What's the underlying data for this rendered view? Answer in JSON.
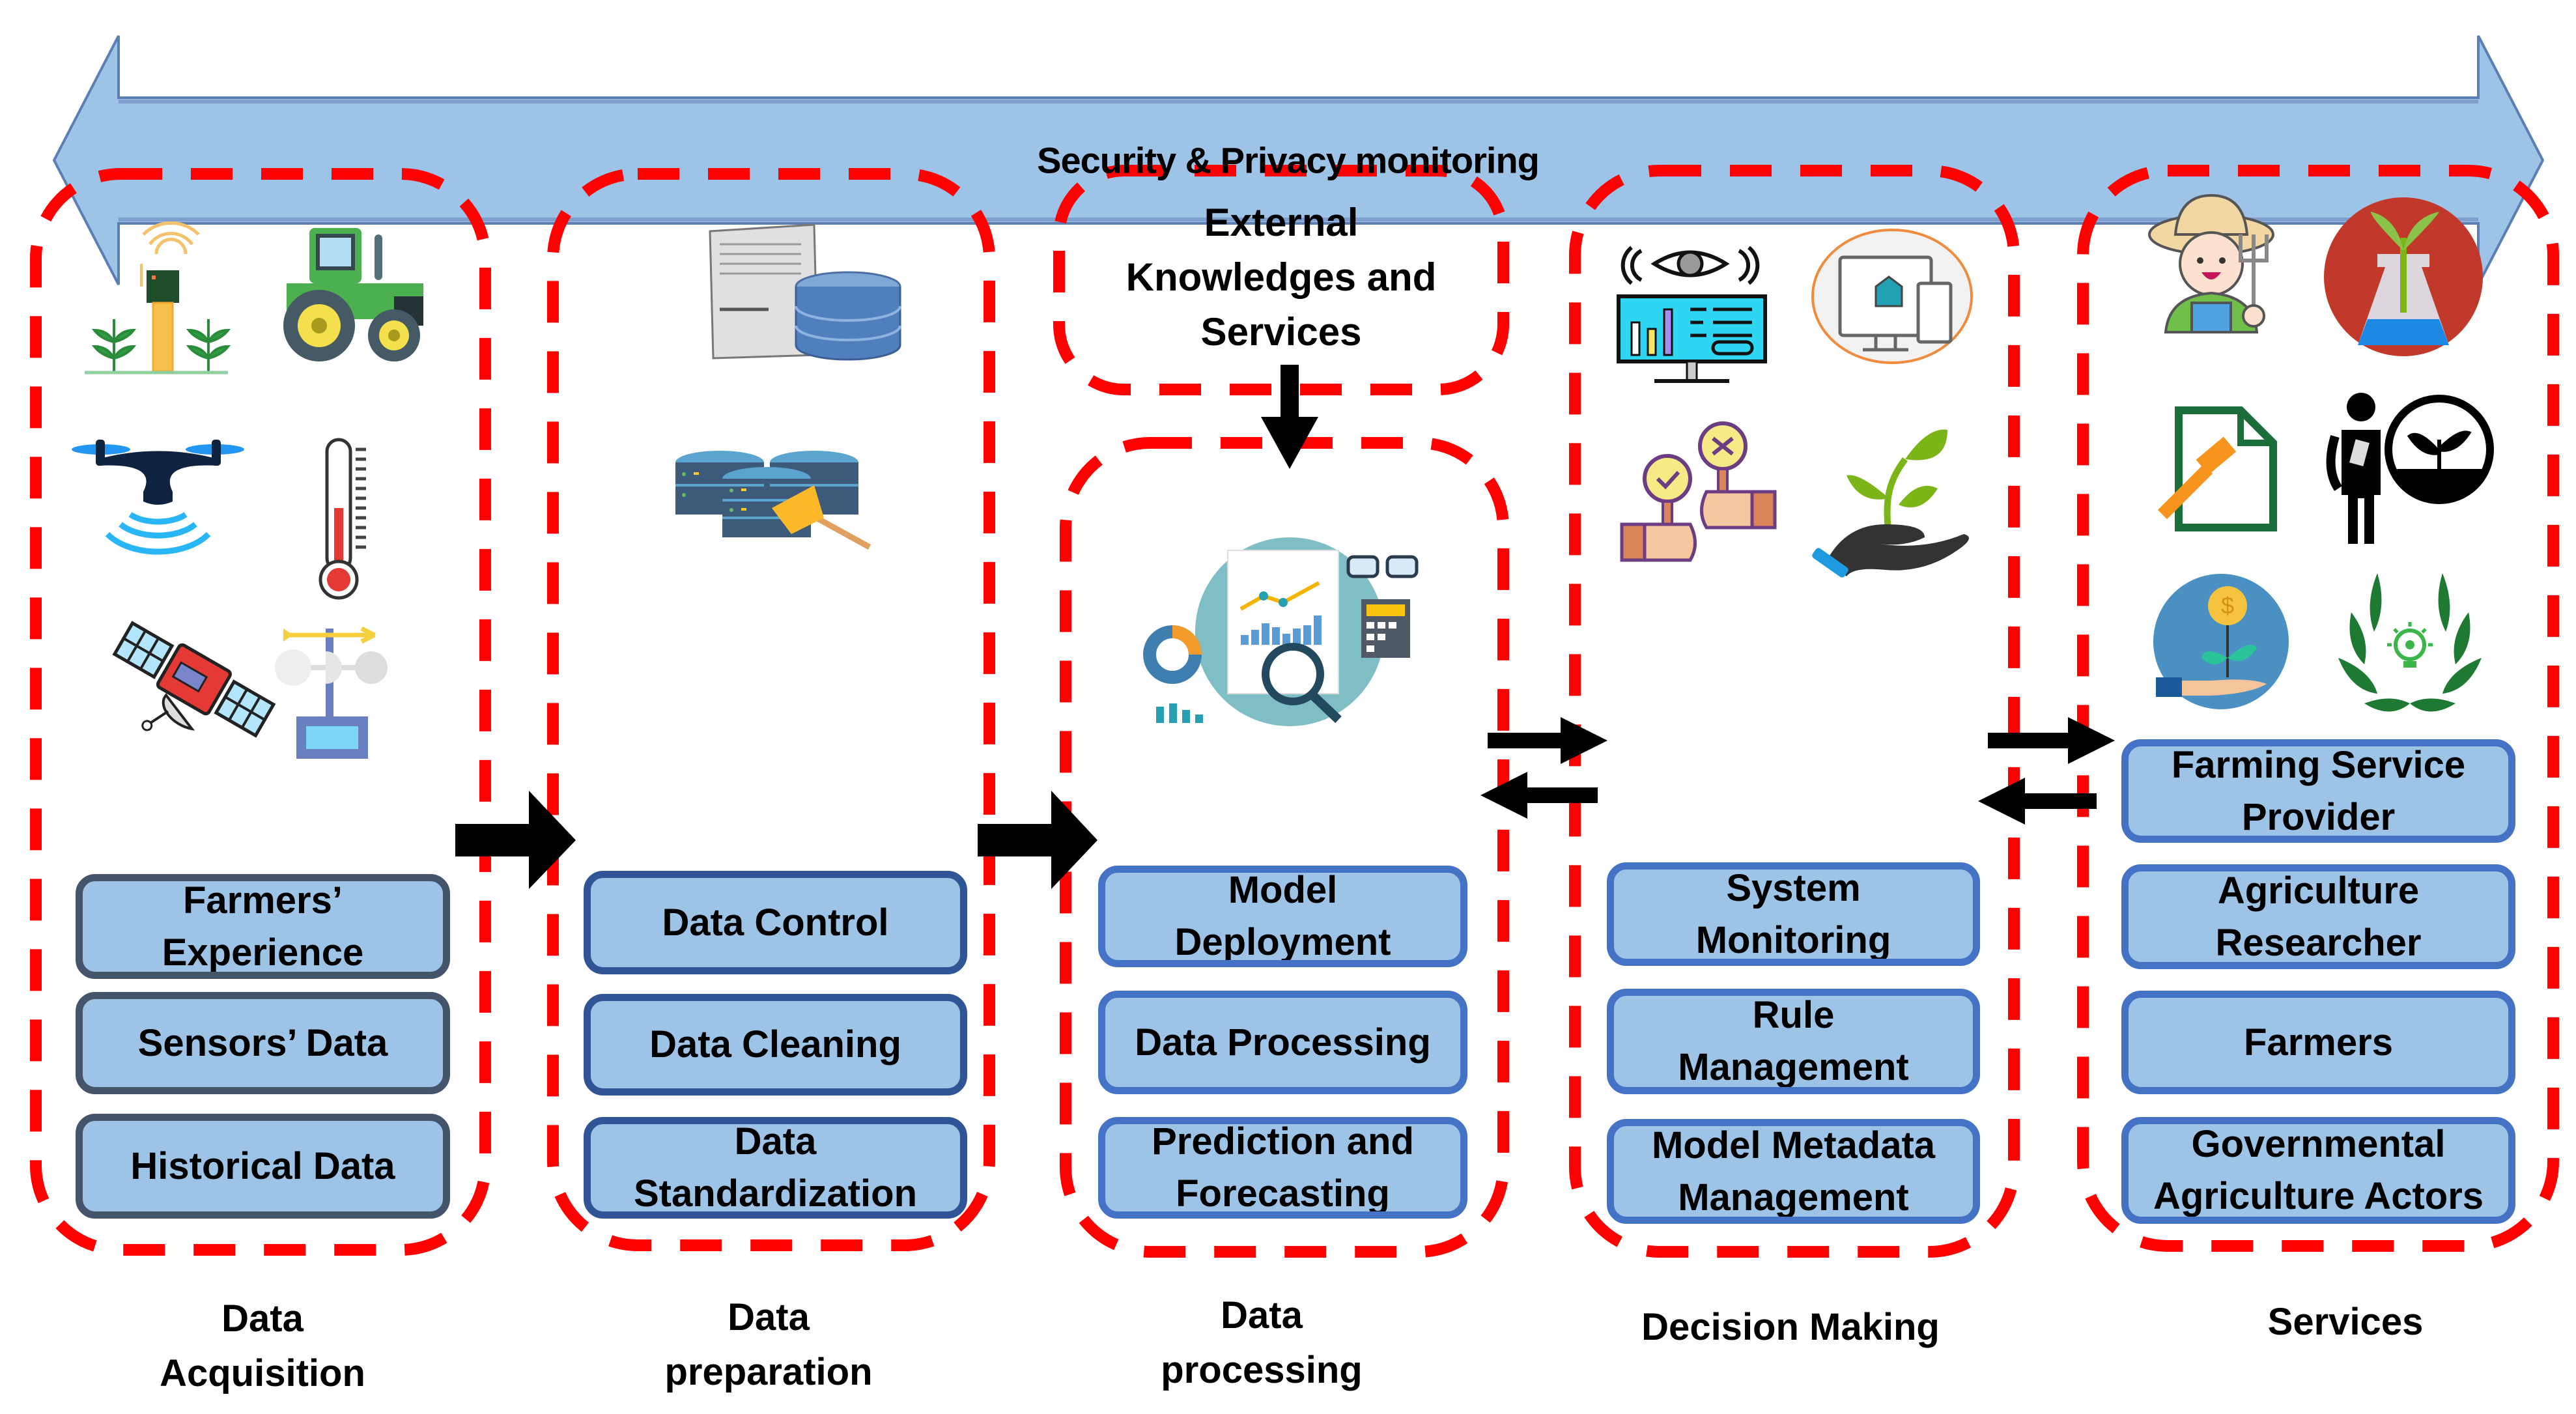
{
  "banner": {
    "label": "Security & Privacy monitoring",
    "direction": "bidirectional",
    "fill_color": "#9dc3e6",
    "border_color": "#5b7fb3"
  },
  "colors": {
    "dashed_border": "#ff0000",
    "sub_box_fill": "#9dc3e6",
    "sub_box_border_acquisition": "#44546a",
    "sub_box_border_preparation": "#2f5597",
    "sub_box_border_default": "#4472c4",
    "arrow": "#000000"
  },
  "external": {
    "label": "External\nKnowledges and\nServices",
    "flows_into": "data-processing"
  },
  "stages": [
    {
      "id": "data-acquisition",
      "label": "Data\nAcquisition",
      "icons": [
        "soil-sensor-icon",
        "tractor-icon",
        "drone-icon",
        "thermometer-icon",
        "satellite-icon",
        "weather-vane-icon"
      ],
      "items": [
        "Farmers’\nExperience",
        "Sensors’ Data",
        "Historical Data"
      ]
    },
    {
      "id": "data-preparation",
      "label": "Data\npreparation",
      "icons": [
        "database-server-icon",
        "database-cleaning-icon"
      ],
      "items": [
        "Data Control",
        "Data Cleaning",
        "Data\nStandardization"
      ]
    },
    {
      "id": "data-processing",
      "label": "Data\nprocessing",
      "icons": [
        "data-analytics-icon"
      ],
      "items": [
        "Model\nDeployment",
        "Data Processing",
        "Prediction and\nForecasting"
      ]
    },
    {
      "id": "decision-making",
      "label": "Decision Making",
      "icons": [
        "monitoring-dashboard-icon",
        "multi-device-icon",
        "approve-reject-icon",
        "hand-plant-icon"
      ],
      "items": [
        "System\nMonitoring",
        "Rule\nManagement",
        "Model Metadata\nManagement"
      ]
    },
    {
      "id": "services",
      "label": "Services",
      "icons": [
        "farmer-icon",
        "plant-lab-icon",
        "legal-document-icon",
        "agronomist-icon",
        "investment-icon",
        "innovation-laurel-icon"
      ],
      "items": [
        "Farming Service\nProvider",
        "Agriculture\nResearcher",
        "Farmers",
        "Governmental\nAgriculture Actors"
      ]
    }
  ],
  "connections": [
    {
      "from": "data-acquisition",
      "to": "data-preparation",
      "type": "one-way"
    },
    {
      "from": "data-preparation",
      "to": "data-processing",
      "type": "one-way"
    },
    {
      "from": "data-processing",
      "to": "decision-making",
      "type": "two-way"
    },
    {
      "from": "decision-making",
      "to": "services",
      "type": "two-way"
    },
    {
      "from": "external",
      "to": "data-processing",
      "type": "one-way"
    }
  ]
}
